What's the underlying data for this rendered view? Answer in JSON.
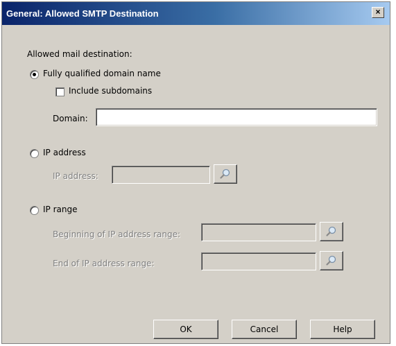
{
  "window": {
    "title": "General: Allowed SMTP Destination",
    "close_glyph": "×"
  },
  "form": {
    "section_label": "Allowed mail destination:",
    "options": {
      "fqdn": {
        "label": "Fully qualified domain name",
        "selected": true
      },
      "ip_address": {
        "label": "IP address",
        "selected": false
      },
      "ip_range": {
        "label": "IP range",
        "selected": false
      }
    },
    "include_subdomains": {
      "label": "Include subdomains",
      "checked": false
    },
    "domain": {
      "label": "Domain:",
      "value": ""
    },
    "ip_address_field": {
      "label": "IP address:",
      "value": ""
    },
    "range_begin": {
      "label": "Beginning of IP address range:",
      "value": ""
    },
    "range_end": {
      "label": "End of IP address range:",
      "value": ""
    }
  },
  "buttons": {
    "ok": "OK",
    "cancel": "Cancel",
    "help": "Help"
  },
  "icons": {
    "browse": "magnifier-icon"
  }
}
